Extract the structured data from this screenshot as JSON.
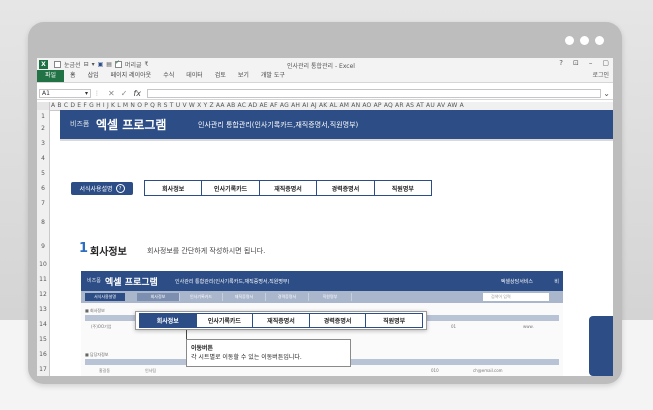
{
  "window": {
    "title": "인사관리 통합관리 - Excel",
    "quick_access": [
      "눈금선",
      "머리글"
    ],
    "controls": [
      "?",
      "⊡",
      "–",
      "▢"
    ]
  },
  "ribbon": {
    "tabs": [
      "파일",
      "홈",
      "삽입",
      "페이지 레이아웃",
      "수식",
      "데이터",
      "검토",
      "보기",
      "개발 도구"
    ],
    "login": "로그인"
  },
  "formula_bar": {
    "name_box": "A1",
    "formula": ""
  },
  "columns": "A B C D E F G H I J K L M N O P Q R S T U V W X Y Z AA AB AC AD AE AF AG AH AI AJ AK AL AM AN AO AP AQ AR AS AT AU AV AW A",
  "rows": [
    "1",
    "2",
    "3",
    "4",
    "5",
    "6",
    "7",
    "8",
    "9",
    "10",
    "11",
    "12",
    "13",
    "14",
    "15",
    "16",
    "17"
  ],
  "banner": {
    "logo": "비즈폼",
    "program": "엑셀 프로그램",
    "subtitle": "인사관리 통합관리(인사기록카드,재직증명서,직원명부)"
  },
  "guide_button": {
    "label": "서식사용설명",
    "icon": "?"
  },
  "nav": [
    "회사정보",
    "인사기록카드",
    "재직증명서",
    "경력증명서",
    "직원명부"
  ],
  "section": {
    "number": "1",
    "title": "회사정보",
    "description": "회사정보를 간단하게 작성하시면 됩니다."
  },
  "preview": {
    "logo": "비즈폼",
    "program": "엑셀 프로그램",
    "subtitle": "인사관리 통합관리(인사기록카드,재직증명서,직원명부)",
    "service": "엑셀상담서비스",
    "extra": "비",
    "guide": "서식사용설명",
    "tabs": [
      "회사정보",
      "인사기록카드",
      "재직증명서",
      "경력증명서",
      "직원명부"
    ],
    "search": "검색어 입력",
    "label1": "■ 회사정보",
    "label2": "■ 담당자정보",
    "cell_a": "(주)OO기업",
    "cell_b": "01",
    "cell_c": "www.",
    "cell_d": "홍길동",
    "cell_e": "인사팀",
    "cell_f": "010",
    "cell_g": "ch@email.com"
  },
  "popup_nav": [
    "회사정보",
    "인사기록카드",
    "재직증명서",
    "경력증명서",
    "직원명부"
  ],
  "tooltip": {
    "title": "이동버튼",
    "text": "각 시트별로 이동할 수 있는 이동버튼입니다."
  }
}
